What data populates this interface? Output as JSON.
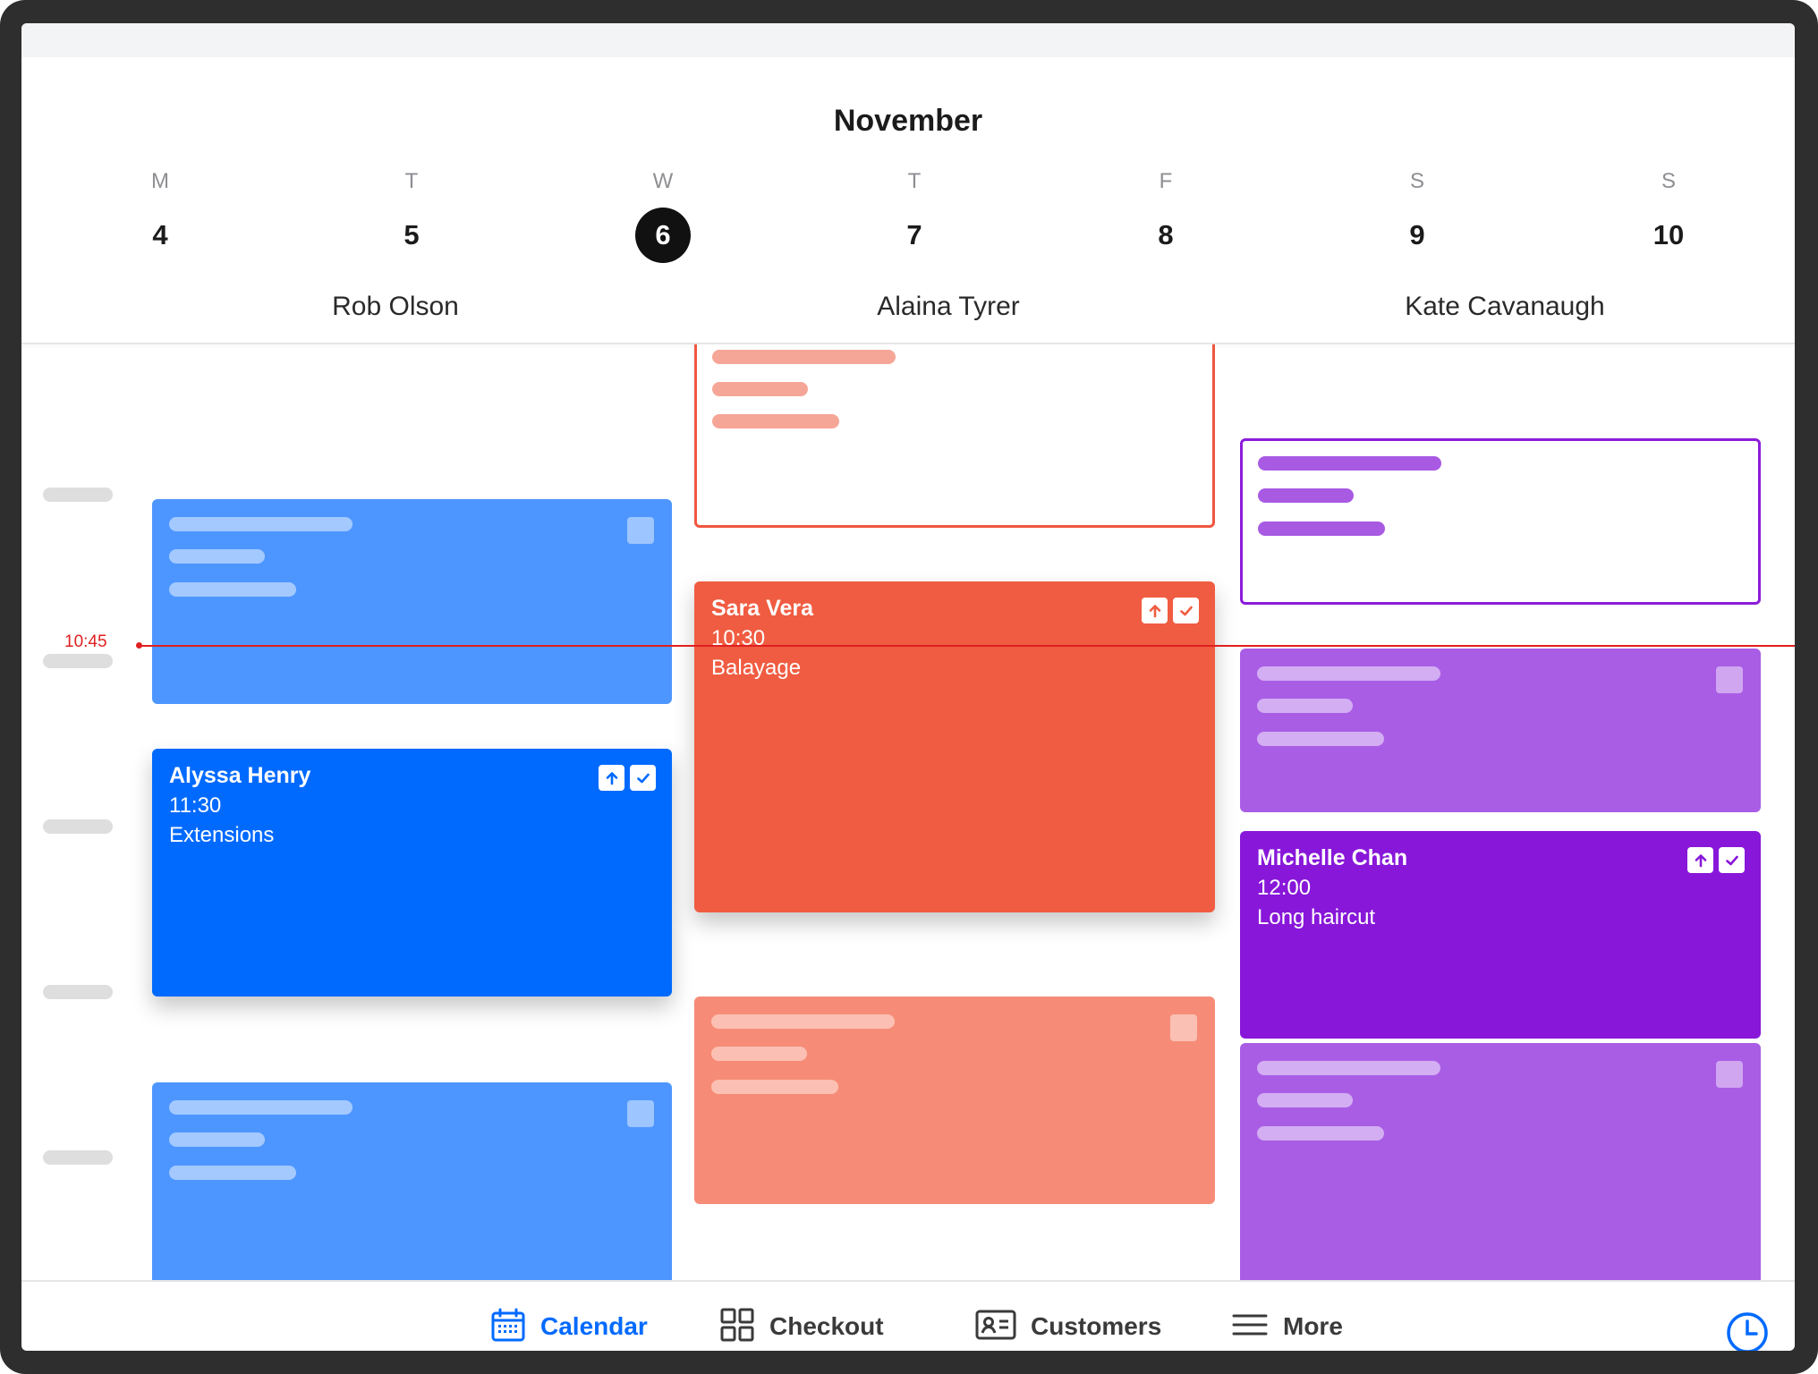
{
  "header": {
    "month": "November",
    "days": [
      {
        "letter": "M",
        "number": "4"
      },
      {
        "letter": "T",
        "number": "5"
      },
      {
        "letter": "W",
        "number": "6",
        "selected": true
      },
      {
        "letter": "T",
        "number": "7"
      },
      {
        "letter": "F",
        "number": "8"
      },
      {
        "letter": "S",
        "number": "9"
      },
      {
        "letter": "S",
        "number": "10"
      }
    ],
    "staff": [
      "Rob Olson",
      "Alaina Tyrer",
      "Kate Cavanaugh"
    ]
  },
  "current_time": "10:45",
  "appointments": {
    "rob": {
      "client": "Alyssa Henry",
      "time": "11:30",
      "service": "Extensions"
    },
    "alaina": {
      "client": "Sara Vera",
      "time": "10:30",
      "service": "Balayage"
    },
    "kate": {
      "client": "Michelle Chan",
      "time": "12:00",
      "service": "Long haircut"
    }
  },
  "nav": {
    "calendar": "Calendar",
    "checkout": "Checkout",
    "customers": "Customers",
    "more": "More"
  },
  "colors": {
    "blue": "#006aff",
    "red": "#f05c41",
    "purple": "#8817d9",
    "now": "#e02020"
  }
}
